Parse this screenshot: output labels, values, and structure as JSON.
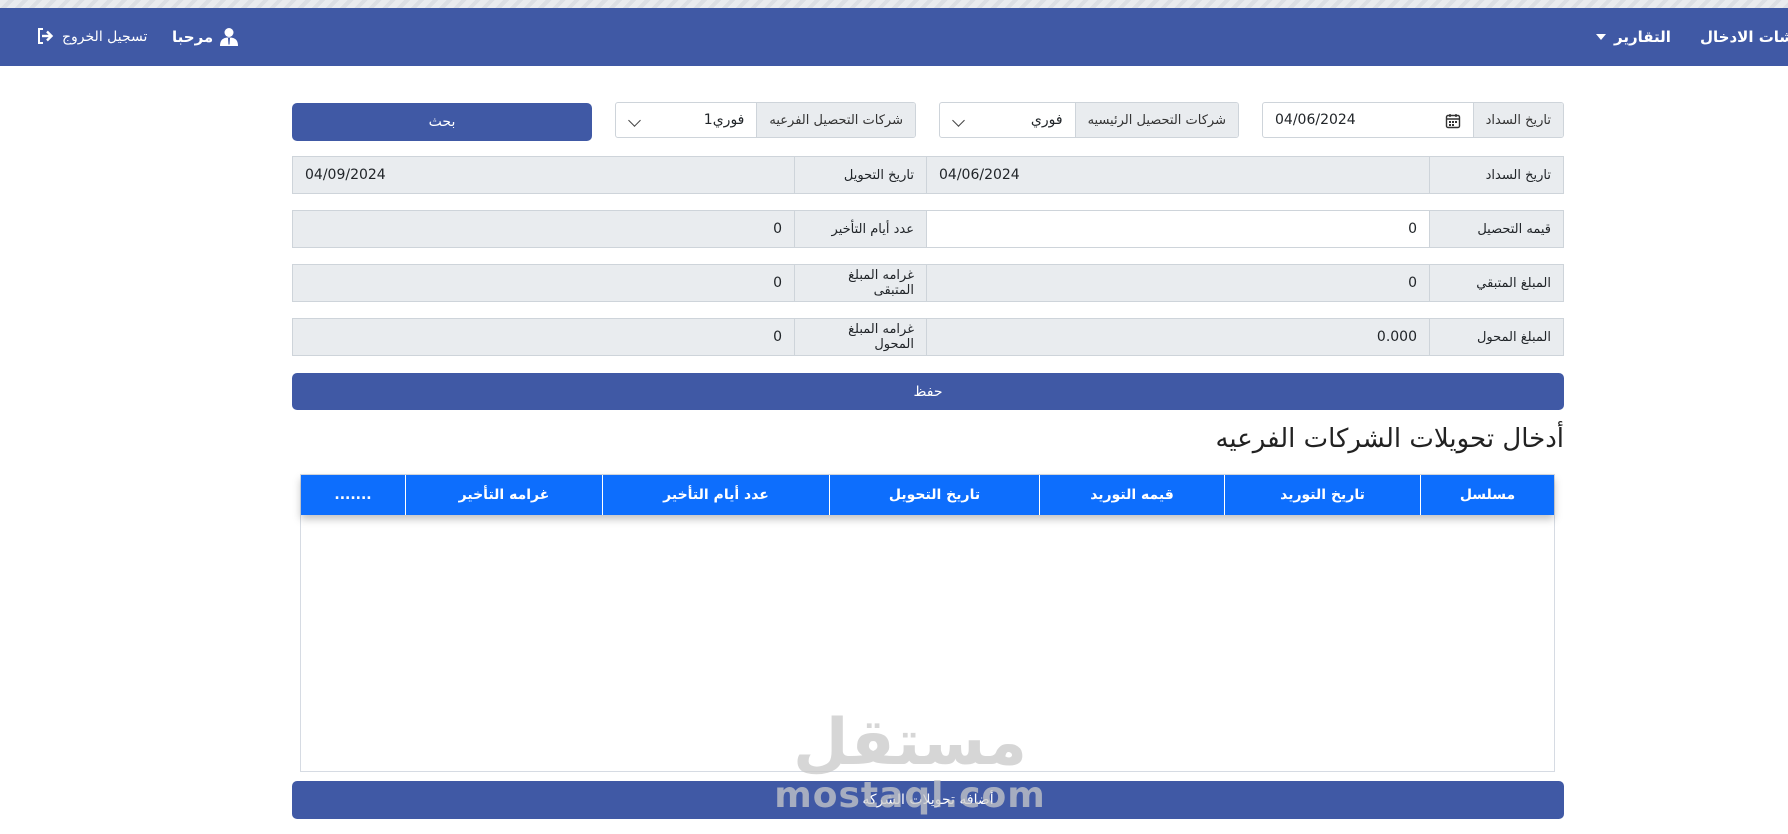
{
  "navbar": {
    "entries_menu": "شات الادخال",
    "reports_menu": "التقارير",
    "welcome": "مرحبا",
    "logout": "تسجيل الخروج"
  },
  "search_form": {
    "payment_date_label": "تاريخ السداد",
    "payment_date_value": "04/06/2024",
    "main_companies_label": "شركات التحصيل الرئيسيه",
    "main_companies_value": "فوري",
    "branch_companies_label": "شركات التحصيل الفرعيه",
    "branch_companies_value": "فوري1",
    "search_button": "بحث"
  },
  "details": {
    "payment_date_label": "تاريخ السداد",
    "payment_date_value": "04/06/2024",
    "transfer_date_label": "تاريخ التحويل",
    "transfer_date_value": "04/09/2024",
    "collection_value_label": "قيمه التحصيل",
    "collection_value": "0",
    "delay_days_label": "عدد أيام التأخير",
    "delay_days_value": "0",
    "remaining_amount_label": "المبلغ المتبقي",
    "remaining_amount_value": "0",
    "remaining_fine_label": "غرامه المبلغ المتبقى",
    "remaining_fine_value": "0",
    "transferred_amount_label": "المبلغ المحول",
    "transferred_amount_value": "0.000",
    "transferred_fine_label": "غرامه المبلغ المحول",
    "transferred_fine_value": "0",
    "save_button": "حفظ"
  },
  "section_title": "أدخال تحويلات الشركات الفرعيه",
  "table": {
    "columns": [
      "مسلسل",
      "تاريخ التوريد",
      "قيمه التوريد",
      "تاريخ التحويل",
      "عدد أيام التأخير",
      "غرامه التأخير",
      "......."
    ]
  },
  "add_button": "أضافه تحويلات الشركه",
  "watermark": {
    "arabic": "مستقل",
    "latin": "mostaql.com"
  },
  "colors": {
    "navbar": "#4059a5",
    "button": "#4059a5",
    "table_header": "#0d6efd",
    "addon_bg": "#e9ecef"
  }
}
